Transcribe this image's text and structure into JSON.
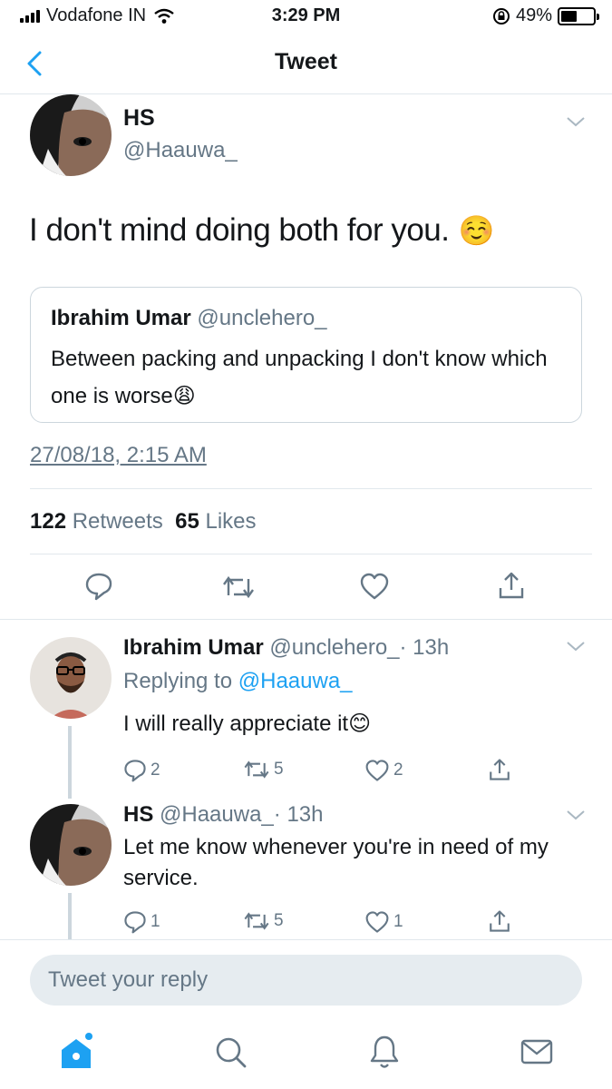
{
  "status_bar": {
    "carrier": "Vodafone IN",
    "time": "3:29 PM",
    "battery": "49%",
    "battery_level": 0.49
  },
  "nav": {
    "title": "Tweet",
    "back_icon": "chevron-left-icon"
  },
  "tweet": {
    "name": "HS",
    "handle": "@Haauwa_",
    "text": "I don't mind doing both for you.",
    "emoji": "☺️",
    "quote": {
      "name": "Ibrahim Umar",
      "handle": "@unclehero_",
      "text": "Between packing and unpacking I don't know which one is worse",
      "emoji": "😩"
    },
    "timestamp": "27/08/18, 2:15 AM",
    "retweets_count": "122",
    "retweets_label": "Retweets",
    "likes_count": "65",
    "likes_label": "Likes"
  },
  "replies": [
    {
      "name": "Ibrahim Umar",
      "handle": "@unclehero_",
      "time": "· 13h",
      "replying_prefix": "Replying to",
      "replying_to": "@Haauwa_",
      "text": "I will really appreciate it",
      "emoji": "😊",
      "reply_count": "2",
      "retweet_count": "5",
      "like_count": "2"
    },
    {
      "name": "HS",
      "handle": "@Haauwa_",
      "time": "· 13h",
      "text": "Let me know whenever you're in need of my service.",
      "reply_count": "1",
      "retweet_count": "5",
      "like_count": "1"
    }
  ],
  "reply_box": {
    "placeholder": "Tweet your reply"
  },
  "tabbar": {
    "items": [
      "home-icon",
      "search-icon",
      "bell-icon",
      "mail-icon"
    ]
  },
  "colors": {
    "accent": "#1da1f2",
    "muted": "#657786",
    "border": "#e1e8ed"
  }
}
